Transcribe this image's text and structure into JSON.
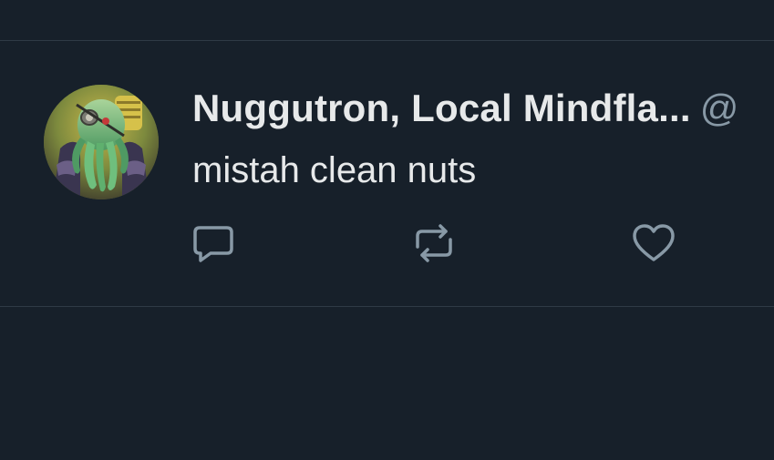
{
  "tweet": {
    "display_name": "Nuggutron, Local Mindfla...",
    "handle": "@",
    "text": "mistah clean nuts"
  },
  "actions": {
    "reply_icon": "reply-icon",
    "retweet_icon": "retweet-icon",
    "like_icon": "heart-icon"
  },
  "colors": {
    "background": "#17202a",
    "divider": "#2f3a45",
    "text_primary": "#e7e9ea",
    "text_secondary": "#8899a6"
  }
}
